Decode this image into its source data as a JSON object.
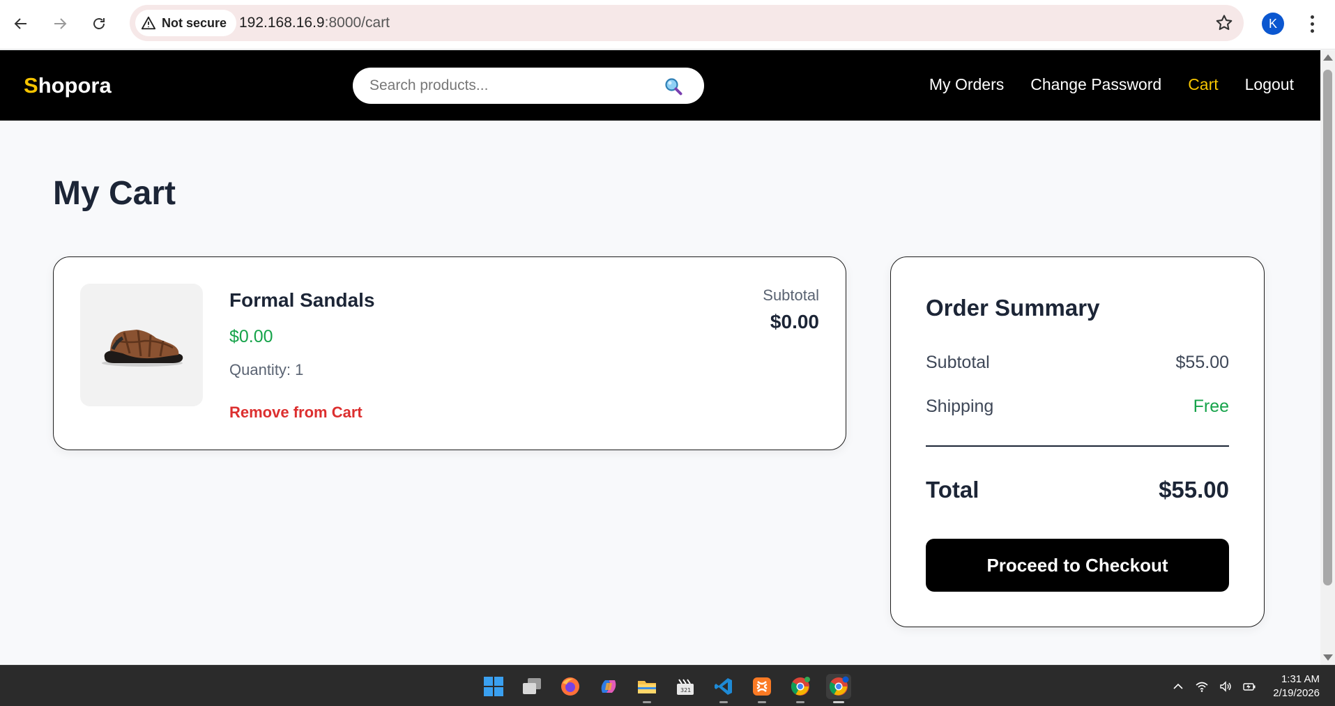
{
  "browser": {
    "security_label": "Not secure",
    "url_host": "192.168.16.9",
    "url_path": ":8000/cart",
    "profile_initial": "K"
  },
  "site": {
    "logo_first_letter": "S",
    "logo_rest": "hopora",
    "search_placeholder": "Search products...",
    "nav": [
      {
        "label": "My Orders",
        "active": false
      },
      {
        "label": "Change Password",
        "active": false
      },
      {
        "label": "Cart",
        "active": true
      },
      {
        "label": "Logout",
        "active": false
      }
    ]
  },
  "cart": {
    "title": "My Cart",
    "items": [
      {
        "name": "Formal Sandals",
        "price": "$0.00",
        "quantity_text": "Quantity: 1",
        "remove_label": "Remove from Cart",
        "subtotal_label": "Subtotal",
        "subtotal_value": "$0.00"
      }
    ]
  },
  "summary": {
    "title": "Order Summary",
    "subtotal_label": "Subtotal",
    "subtotal_value": "$55.00",
    "shipping_label": "Shipping",
    "shipping_value": "Free",
    "total_label": "Total",
    "total_value": "$55.00",
    "checkout_label": "Proceed to Checkout"
  },
  "taskbar": {
    "apps": [
      "windows-start",
      "task-view",
      "firefox",
      "copilot",
      "file-explorer",
      "video-editor",
      "vs-code",
      "xampp",
      "chrome",
      "chrome-profile-k"
    ],
    "time": "1:31 AM",
    "date": "2/19/2026"
  },
  "colors": {
    "accent_yellow": "#f6c400",
    "price_green": "#16a34a",
    "remove_red": "#dc2f2f",
    "navbar_bg": "#000000"
  }
}
